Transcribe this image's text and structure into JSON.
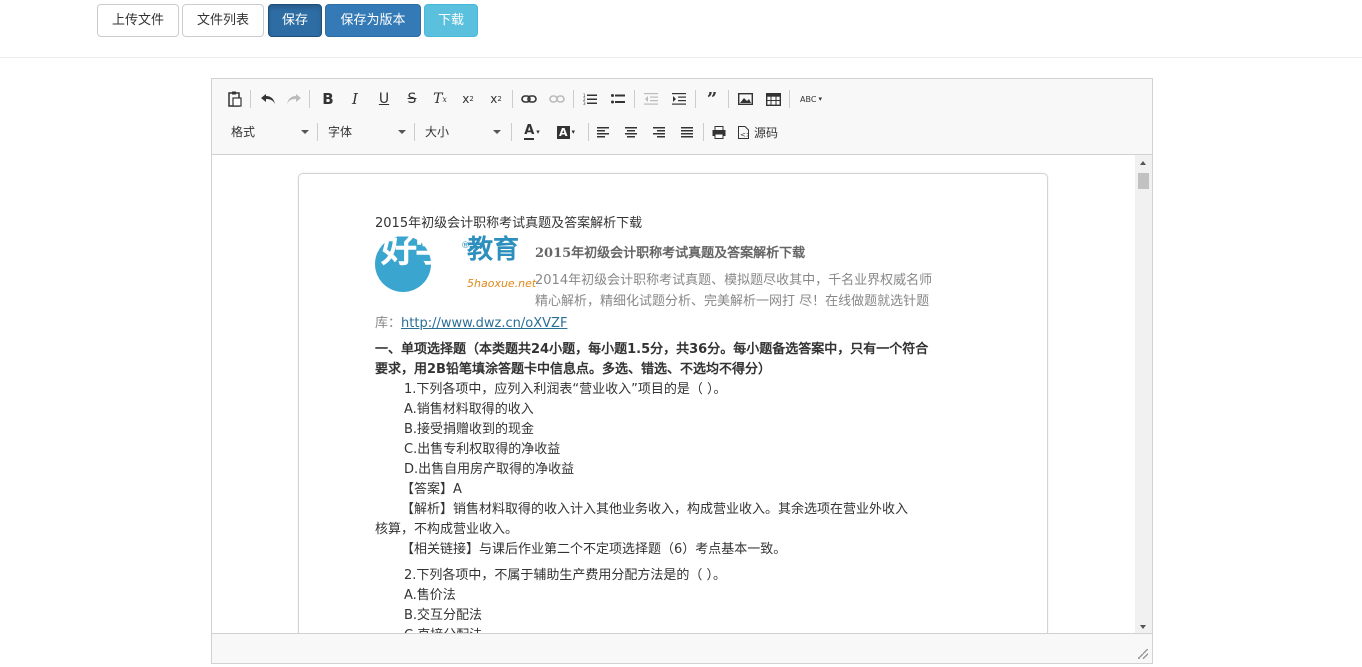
{
  "buttons": {
    "upload": "上传文件",
    "file_list": "文件列表",
    "save": "保存",
    "save_version": "保存为版本",
    "download": "下载"
  },
  "toolbar": {
    "format": "格式",
    "font": "字体",
    "size": "大小",
    "source": "源码"
  },
  "doc": {
    "heading": "2015年初级会计职称考试真题及答案解析下载",
    "logo_zh1": "好学",
    "logo_zh2": "教育",
    "logo_en": "5haoxue.net",
    "logo_reg": "®",
    "promo_title": "2015年初级会计职称考试真题及答案解析下载",
    "promo_line1": "2014年初级会计职称考试真题、模拟题尽收其中，千名业界权威名师",
    "promo_line2": "精心解析，精细化试题分析、完美解析一网打 尽！在线做题就选针题",
    "lib_prefix": "库：",
    "link": "http://www.dwz.cn/oXVZF",
    "section1_l1": "一、单项选择题（本类题共24小题，每小题1.5分，共36分。每小题备选答案中，只有一个符合",
    "section1_l2": "要求，用2B铅笔填涂答题卡中信息点。多选、错选、不选均不得分）",
    "q1": "1.下列各项中，应列入利润表“营业收入”项目的是（ ）。",
    "q1a": "A.销售材料取得的收入",
    "q1b": "B.接受捐赠收到的现金",
    "q1c": "C.出售专利权取得的净收益",
    "q1d": "D.出售自用房产取得的净收益",
    "q1_answer": "【答案】A",
    "q1_analysis_l1": "【解析】销售材料取得的收入计入其他业务收入，构成营业收入。其余选项在营业外收入",
    "q1_analysis_l2": "核算，不构成营业收入。",
    "q1_link": "【相关链接】与课后作业第二个不定项选择题（6）考点基本一致。",
    "q2": "2.下列各项中，不属于辅助生产费用分配方法是的（ ）。",
    "q2a": "A.售价法",
    "q2b": "B.交互分配法",
    "q2c": "C.直接分配法"
  }
}
